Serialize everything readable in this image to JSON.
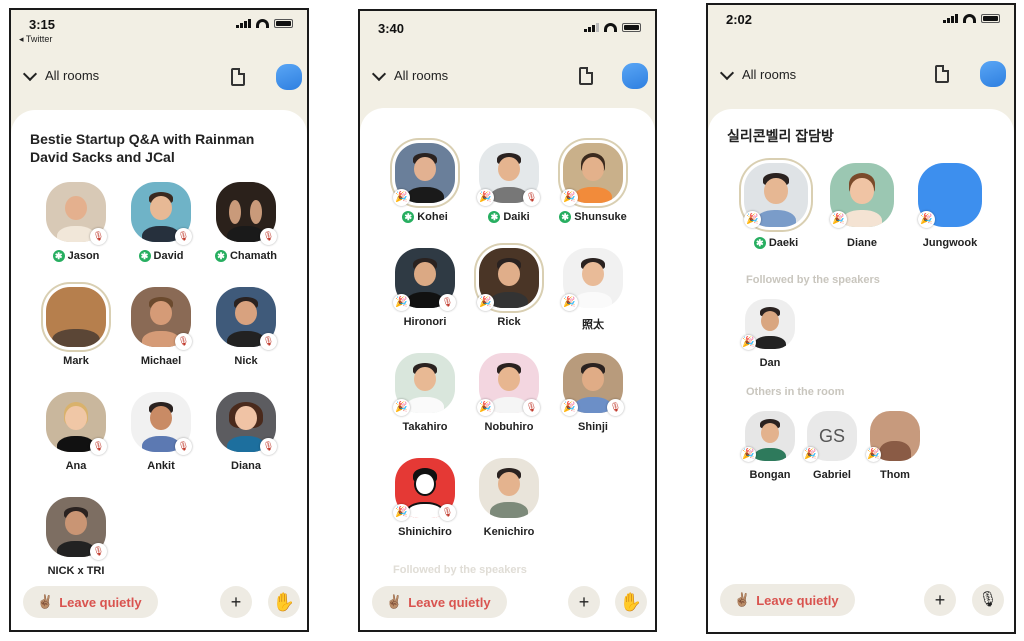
{
  "common": {
    "all_rooms": "All rooms",
    "leave_label": "Leave quietly",
    "leave_emoji": "✌🏽",
    "plus_glyph": "+",
    "hand_glyph": "✋",
    "mic_glyph": "🎙",
    "mod_glyph": "✱",
    "colors": {
      "background": "#f2efe4",
      "card": "#ffffff",
      "leave_text": "#d9534f",
      "moderator": "#27ae60",
      "avatar_blue": "#3d8fee"
    }
  },
  "phone1": {
    "time": "3:15",
    "back_app": "◂ Twitter",
    "room_title": "Bestie Startup Q&A with Rainman David Sacks and JCal",
    "speakers": [
      {
        "name": "Jason",
        "moderator": true
      },
      {
        "name": "David",
        "moderator": true
      },
      {
        "name": "Chamath",
        "moderator": true
      },
      {
        "name": "Mark"
      },
      {
        "name": "Michael"
      },
      {
        "name": "Nick"
      },
      {
        "name": "Ana"
      },
      {
        "name": "Ankit"
      },
      {
        "name": "Diana"
      },
      {
        "name": "NICK x TRI"
      }
    ]
  },
  "phone2": {
    "time": "3:40",
    "speakers": [
      {
        "name": "Kohei",
        "moderator": true
      },
      {
        "name": "Daiki",
        "moderator": true
      },
      {
        "name": "Shunsuke",
        "moderator": true
      },
      {
        "name": "Hironori"
      },
      {
        "name": "Rick"
      },
      {
        "name": "照太"
      },
      {
        "name": "Takahiro"
      },
      {
        "name": "Nobuhiro"
      },
      {
        "name": "Shinji"
      },
      {
        "name": "Shinichiro"
      },
      {
        "name": "Kenichiro"
      }
    ],
    "faded_section": "Followed by the speakers"
  },
  "phone3": {
    "time": "2:02",
    "room_title": "실리콘벨리 잡담방",
    "speakers": [
      {
        "name": "Daeki",
        "moderator": true
      },
      {
        "name": "Diane"
      },
      {
        "name": "Jungwook"
      }
    ],
    "followed_label": "Followed by the speakers",
    "followed": [
      {
        "name": "Dan"
      }
    ],
    "others_label": "Others in the room",
    "others": [
      {
        "name": "Bongan"
      },
      {
        "name": "Gabriel",
        "initials": "GS"
      },
      {
        "name": "Thom"
      }
    ]
  }
}
